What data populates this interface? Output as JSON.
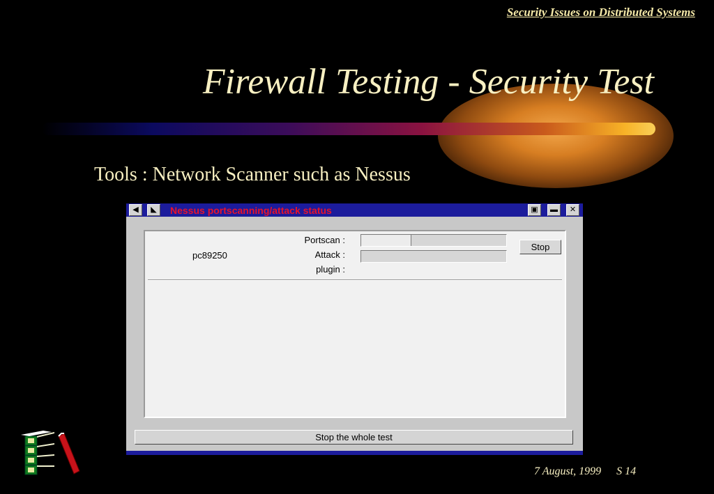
{
  "header": {
    "course_title": "Security Issues on Distributed Systems"
  },
  "slide": {
    "title": "Firewall Testing - Security Test",
    "subtitle": "Tools : Network Scanner such as Nessus"
  },
  "window": {
    "title": "Nessus portscanning/attack status",
    "host": "pc89250",
    "labels": {
      "portscan": "Portscan :",
      "attack": "Attack :",
      "plugin": "plugin :"
    },
    "portscan_progress": 0.34,
    "attack_progress": 0.0,
    "stop_label": "Stop",
    "stop_all_label": "Stop the whole test"
  },
  "footer": {
    "date": "7 August, 1999",
    "slide_number": "S 14"
  },
  "colors": {
    "background": "#000000",
    "text": "#f8f0c2",
    "window_titlebar": "#1c1c9c",
    "window_title_text": "#e8132a",
    "window_body": "#c8c8c8"
  }
}
